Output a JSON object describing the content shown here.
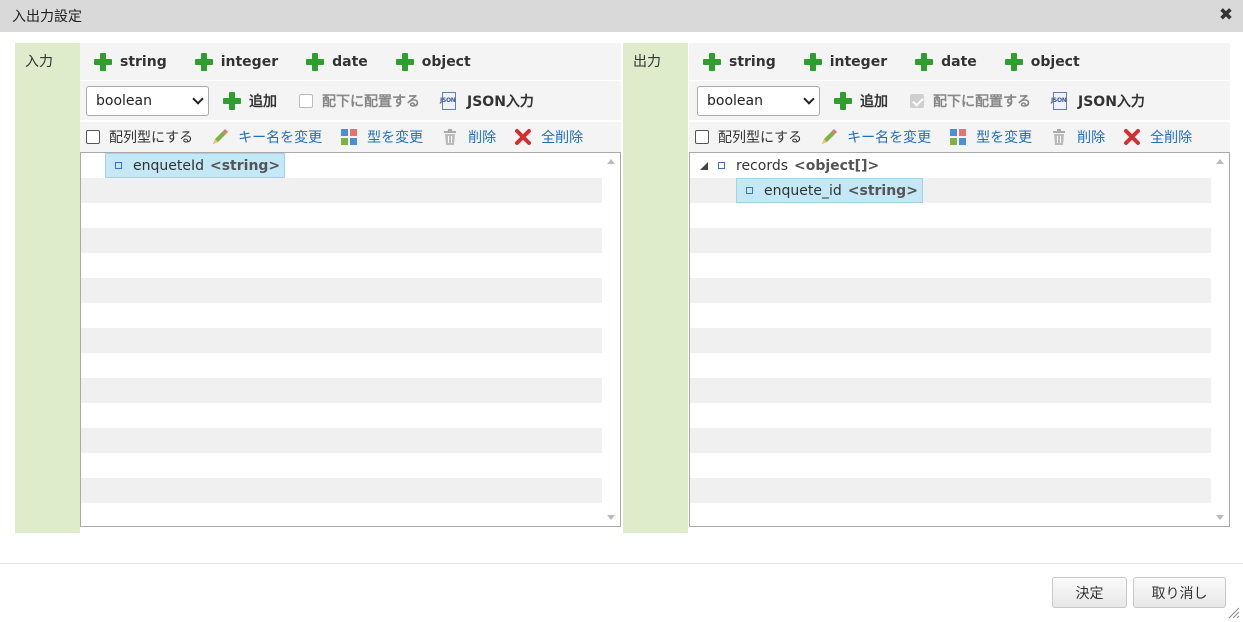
{
  "dialog": {
    "title": "入出力設定"
  },
  "input": {
    "section_label": "入力",
    "type_buttons": [
      "string",
      "integer",
      "date",
      "object"
    ],
    "type_select": "boolean",
    "add_label": "追加",
    "place_under_label": "配下に配置する",
    "place_under_checked": false,
    "json_input_label": "JSON入力",
    "array_label": "配列型にする",
    "actions": {
      "rename": "キー名を変更",
      "change_type": "型を変更",
      "delete": "削除",
      "delete_all": "全削除"
    },
    "tree": [
      {
        "name": "enqueteId",
        "type": "<string>",
        "depth": 1,
        "selected": true
      }
    ]
  },
  "output": {
    "section_label": "出力",
    "type_buttons": [
      "string",
      "integer",
      "date",
      "object"
    ],
    "type_select": "boolean",
    "add_label": "追加",
    "place_under_label": "配下に配置する",
    "place_under_checked": true,
    "json_input_label": "JSON入力",
    "array_label": "配列型にする",
    "actions": {
      "rename": "キー名を変更",
      "change_type": "型を変更",
      "delete": "削除",
      "delete_all": "全削除"
    },
    "tree": [
      {
        "name": "records",
        "type": "<object[]>",
        "depth": 0,
        "expanded": true,
        "selected": false
      },
      {
        "name": "enquete_id",
        "type": "<string>",
        "depth": 1,
        "selected": true
      }
    ]
  },
  "footer": {
    "ok_label": "決定",
    "cancel_label": "取り消し"
  }
}
